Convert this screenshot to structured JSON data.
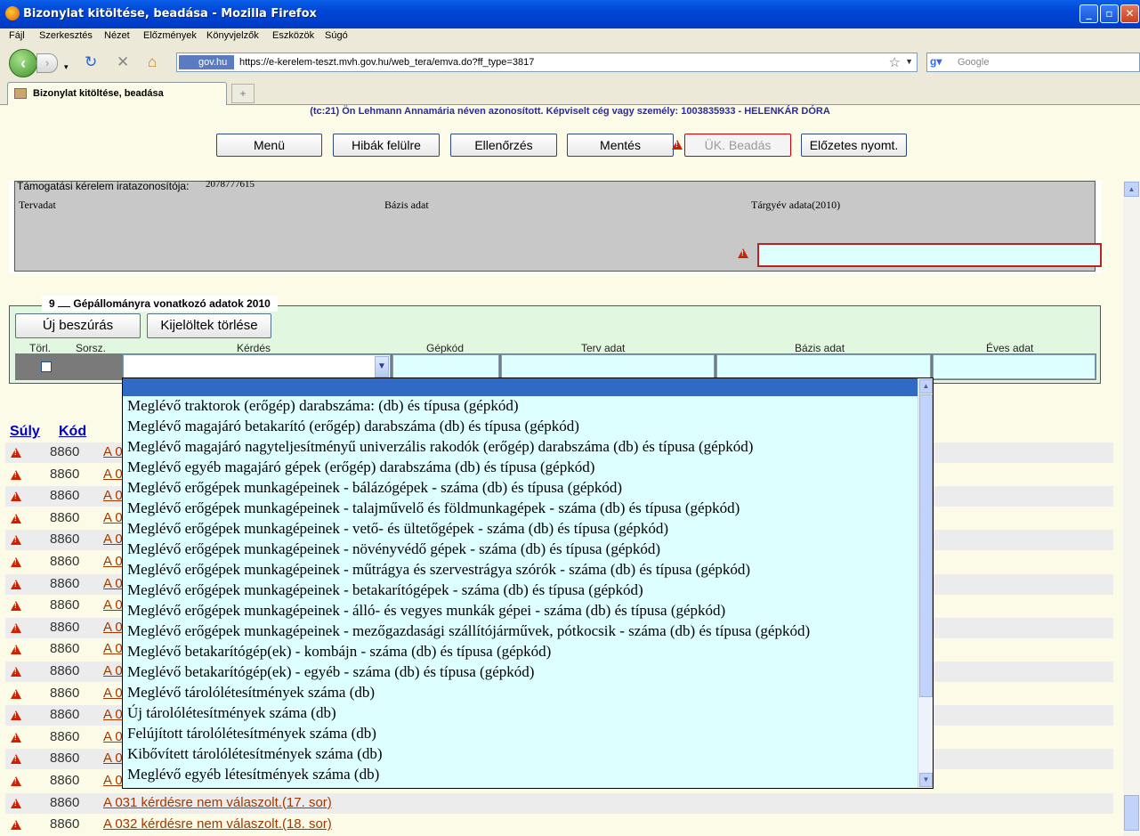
{
  "window": {
    "title": "Bizonylat kitöltése, beadása - Mozilla Firefox"
  },
  "menu": [
    "Fájl",
    "Szerkesztés",
    "Nézet",
    "Előzmények",
    "Könyvjelzők",
    "Eszközök",
    "Súgó"
  ],
  "nav": {
    "site_badge": "gov.hu",
    "url": "https://e-kerelem-teszt.mvh.gov.hu/web_tera/emva.do?ff_type=3817",
    "search_placeholder": "Google"
  },
  "tab": {
    "label": "Bizonylat kitöltése, beadása"
  },
  "page": {
    "ident_text": "(tc:21) Ön Lehmann Annamária néven azonosított.  Képviselt cég vagy személy: 1003835933 - HELENKÁR DÓRA",
    "toolbar": [
      "Menü",
      "Hibák felülre",
      "Ellenőrzés",
      "Mentés",
      "ÜK. Beadás",
      "Előzetes nyomt."
    ],
    "panel1": {
      "ident_label": "Támogatási kérelem iratazonosítója:",
      "ident_value": "2078777615",
      "col_tervadat": "Tervadat",
      "col_bazis": "Bázis adat",
      "col_targyev": "Tárgyév adata(2010)"
    },
    "section9": {
      "number": "9",
      "title": "Gépállományra vonatkozó adatok 2010",
      "btn_new": "Új beszúrás",
      "btn_delete": "Kijelöltek törlése",
      "columns": [
        "Törl.",
        "Sorsz.",
        "Kérdés",
        "Gépkód",
        "Terv adat",
        "Bázis adat",
        "Éves adat"
      ]
    },
    "list_headers": [
      "Súly",
      "Kód"
    ],
    "error_rows": [
      {
        "code": "8860",
        "text": "A 0"
      },
      {
        "code": "8860",
        "text": "A 0"
      },
      {
        "code": "8860",
        "text": "A 0"
      },
      {
        "code": "8860",
        "text": "A 0"
      },
      {
        "code": "8860",
        "text": "A 0"
      },
      {
        "code": "8860",
        "text": "A 0"
      },
      {
        "code": "8860",
        "text": "A 0"
      },
      {
        "code": "8860",
        "text": "A 0"
      },
      {
        "code": "8860",
        "text": "A 0"
      },
      {
        "code": "8860",
        "text": "A 0"
      },
      {
        "code": "8860",
        "text": "A 0"
      },
      {
        "code": "8860",
        "text": "A 0"
      },
      {
        "code": "8860",
        "text": "A 0"
      },
      {
        "code": "8860",
        "text": "A 0"
      },
      {
        "code": "8860",
        "text": "A 0"
      },
      {
        "code": "8860",
        "text": "A 0"
      },
      {
        "code": "8860",
        "text": "A 031 kérdésre nem válaszolt.(17. sor)"
      },
      {
        "code": "8860",
        "text": "A 032 kérdésre nem válaszolt.(18. sor)"
      }
    ],
    "dropdown_options": [
      "Meglévő traktorok (erőgép) darabszáma: (db) és típusa (gépkód)",
      "Meglévő magajáró betakarító (erőgép) darabszáma (db) és típusa (gépkód)",
      "Meglévő magajáró nagyteljesítményű univerzális rakodók (erőgép) darabszáma (db) és típusa (gépkód)",
      "Meglévő egyéb magajáró gépek (erőgép) darabszáma (db) és típusa (gépkód)",
      "Meglévő erőgépek munkagépeinek - bálázógépek - száma (db) és típusa (gépkód)",
      "Meglévő erőgépek munkagépeinek - talajművelő és földmunkagépek - száma (db) és típusa (gépkód)",
      "Meglévő erőgépek munkagépeinek - vető- és ültetőgépek - száma (db) és típusa (gépkód)",
      "Meglévő erőgépek munkagépeinek - növényvédő gépek - száma (db) és típusa (gépkód)",
      "Meglévő erőgépek munkagépeinek - műtrágya és szervestrágya szórók - száma (db) és típusa (gépkód)",
      "Meglévő erőgépek munkagépeinek - betakarítógépek - száma (db) és típusa (gépkód)",
      "Meglévő erőgépek munkagépeinek - álló- és vegyes munkák gépei - száma (db) és típusa (gépkód)",
      "Meglévő erőgépek munkagépeinek - mezőgazdasági szállítójárművek, pótkocsik - száma (db) és típusa (gépkód)",
      "Meglévő betakarítógép(ek) - kombájn - száma (db) és típusa (gépkód)",
      "Meglévő betakarítógép(ek) - egyéb - száma (db) és típusa (gépkód)",
      "Meglévő tárolólétesítmények száma (db)",
      "Új tárolólétesítmények száma (db)",
      "Felújított tárolólétesítmények száma (db)",
      "Kibővített tárolólétesítmények száma (db)",
      "Meglévő egyéb létesítmények  száma (db)"
    ]
  },
  "colors": {
    "titlebar": "#0046d5",
    "page_bg": "#fcfbe8",
    "section_bg": "#e2f7e0",
    "input_bg": "#ddffff",
    "highlight": "#316ac5",
    "warning": "#d02000"
  }
}
